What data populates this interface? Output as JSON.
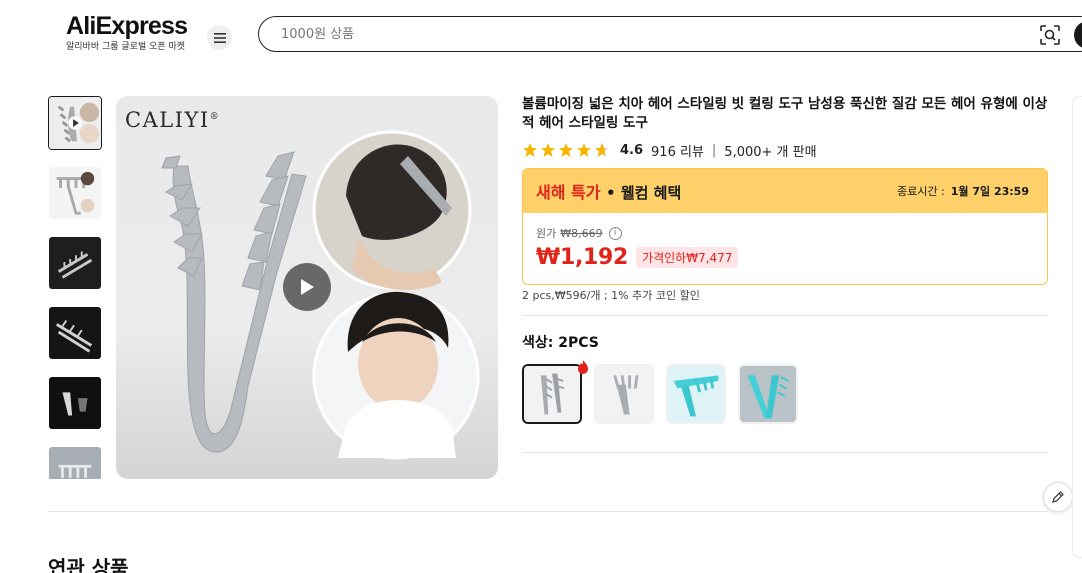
{
  "header": {
    "logo_text": "AliExpress",
    "logo_subtitle": "알리바바 그룹 글로벌 오픈 마켓",
    "search_placeholder": "1000원 상품",
    "menu_icon": "hamburger-icon",
    "image_search_icon": "camera-lens-icon"
  },
  "gallery": {
    "brand_text": "CALIYI",
    "thumbnails": [
      {
        "name": "thumb-1",
        "active": true
      },
      {
        "name": "thumb-2"
      },
      {
        "name": "thumb-3"
      },
      {
        "name": "thumb-4"
      },
      {
        "name": "thumb-5"
      },
      {
        "name": "thumb-6"
      }
    ]
  },
  "product": {
    "title": "볼륨마이징 넓은 치아 헤어 스타일링 빗 컬링 도구 남성용 푹신한 질감 모든 헤어 유형에 이상적 헤어 스타일링 도구",
    "rating": "4.6",
    "reviews": "916 리뷰",
    "sold": "5,000+ 개 판매",
    "rating_value": 4.6
  },
  "promo": {
    "title": "새해 특가",
    "welcome": "• 웰컴 혜택",
    "end_label": "종료시간 :",
    "end_time": "1월 7일 23:59",
    "original_label": "원가",
    "original_price": "₩8,669",
    "price": "₩1,192",
    "discount": "가격인하₩7,477",
    "bulk": "2 pcs,₩596/개 ; 1% 추가 코인 할인"
  },
  "variant": {
    "label": "색상: 2PCS",
    "options": [
      {
        "name": "2PCS gray",
        "active": true
      },
      {
        "name": "gray single"
      },
      {
        "name": "cyan single"
      },
      {
        "name": "cyan pair"
      }
    ]
  },
  "related": {
    "title": "연관 상품"
  },
  "colors": {
    "accent_red": "#e2231a",
    "promo_yellow": "#fdd06a",
    "promo_border": "#f5c94c",
    "star_yellow": "#f7b500",
    "comb_gray": "#b9bcc0",
    "comb_cyan": "#45d0d8"
  }
}
